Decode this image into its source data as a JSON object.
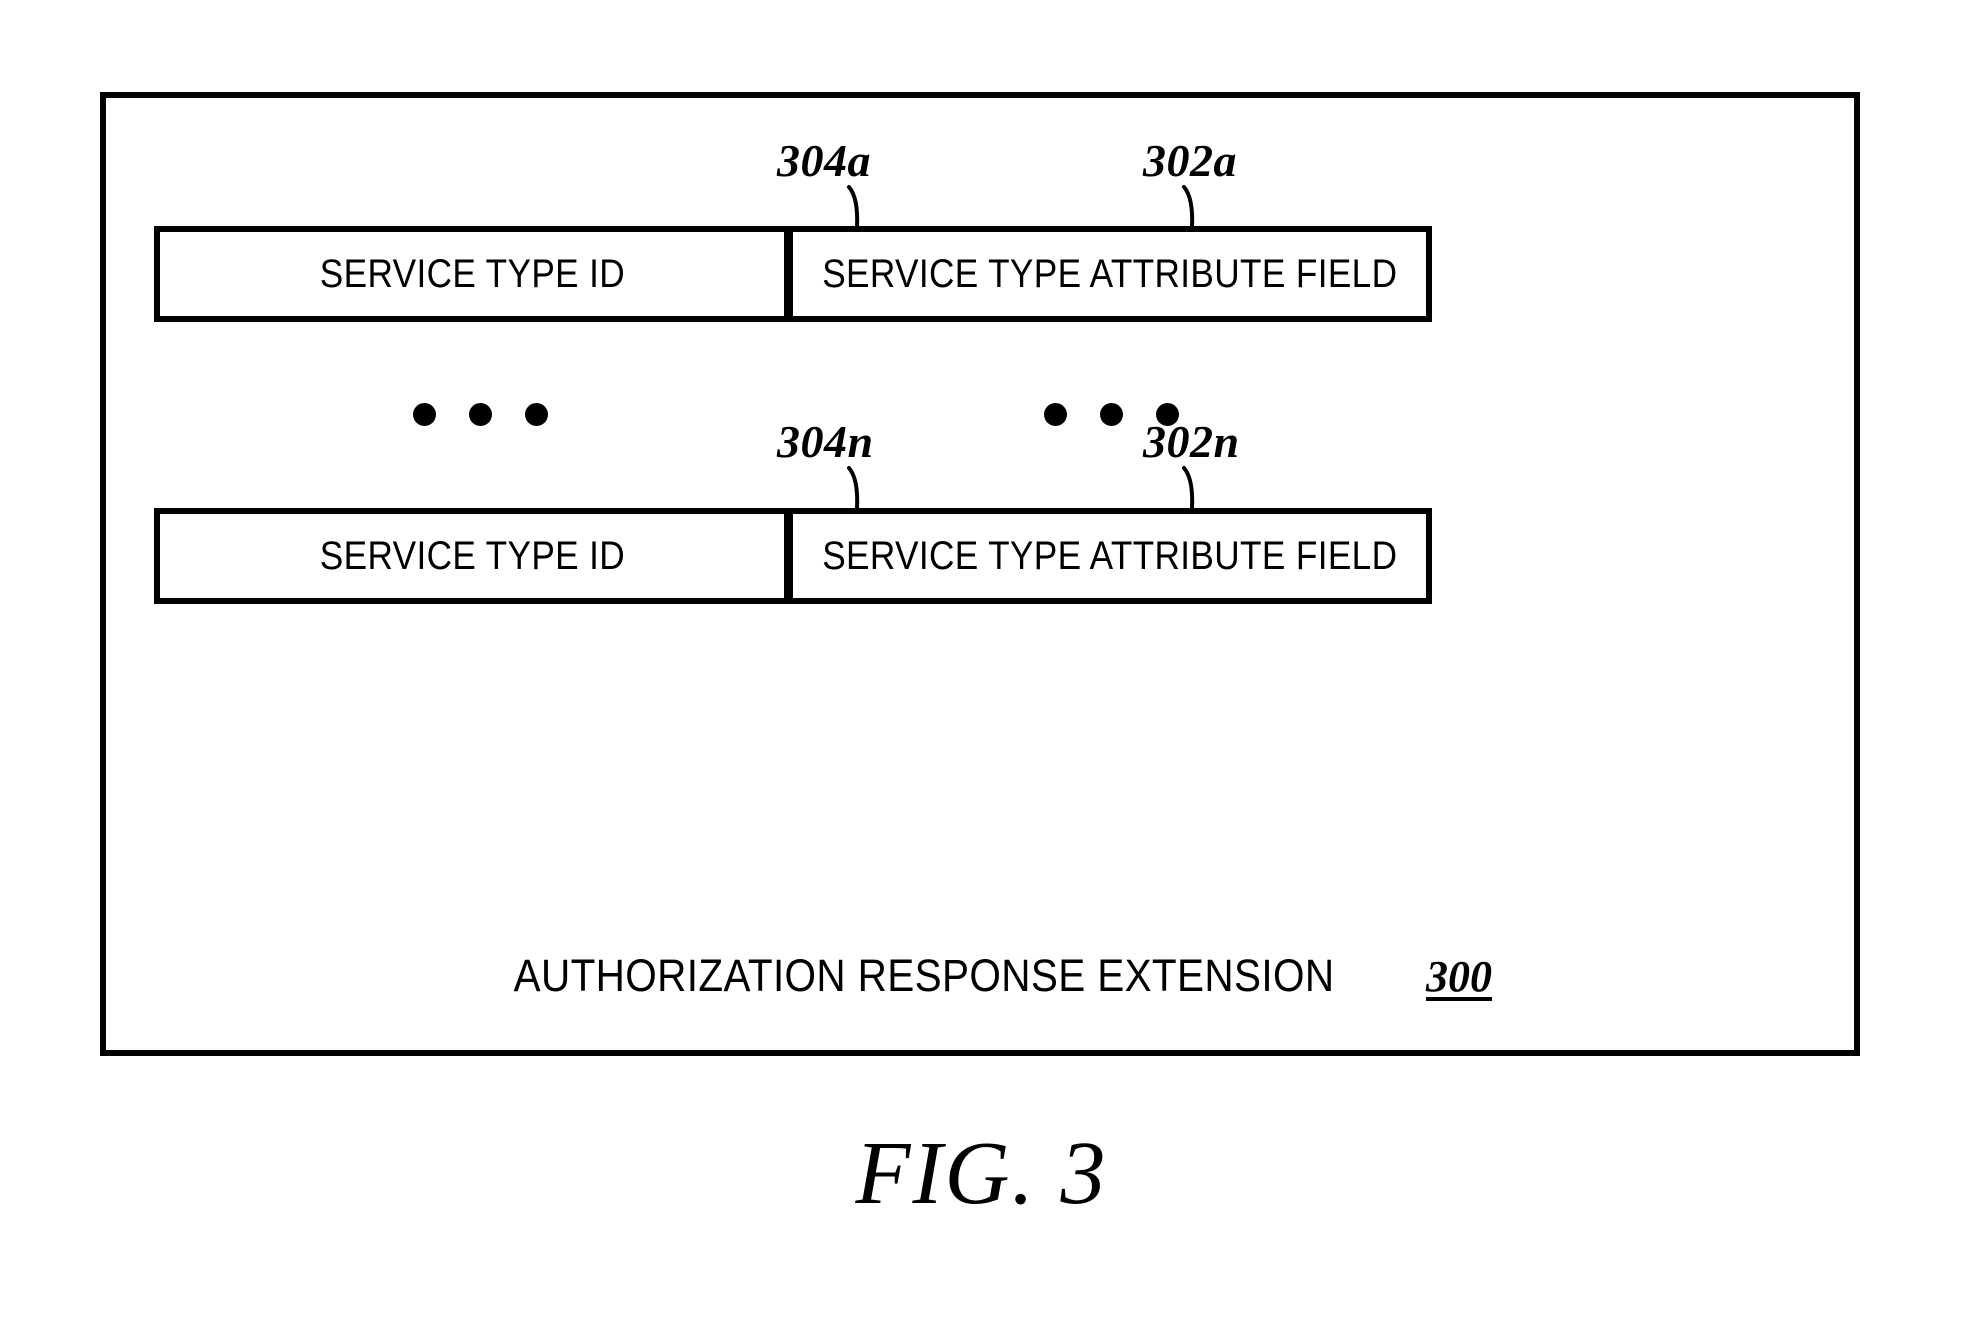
{
  "figure": {
    "number_label": "FIG. 3",
    "frame_caption": "AUTHORIZATION RESPONSE EXTENSION",
    "frame_caption_ref": "300"
  },
  "callouts": {
    "row_a_left": "304a",
    "row_a_right": "302a",
    "row_n_left": "304n",
    "row_n_right": "302n"
  },
  "rows": [
    {
      "id": "row-a",
      "left_cell": "SERVICE TYPE ID",
      "right_cell": "SERVICE TYPE ATTRIBUTE FIELD"
    },
    {
      "id": "row-n",
      "left_cell": "SERVICE TYPE ID",
      "right_cell": "SERVICE TYPE ATTRIBUTE FIELD"
    }
  ],
  "ellipsis": {
    "left_group": "• • •",
    "right_group": "• • •",
    "dot_count": 3
  },
  "colors": {
    "ink": "#000000",
    "paper": "#ffffff"
  }
}
